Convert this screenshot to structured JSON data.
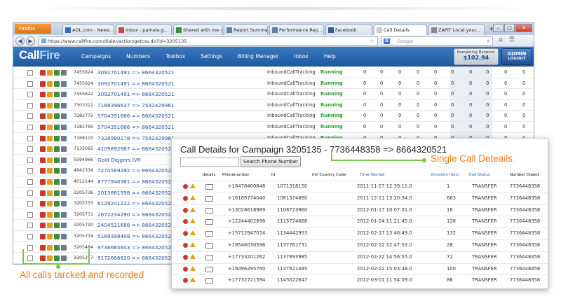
{
  "browser": {
    "app_button": "Firefox",
    "tabs": [
      {
        "label": "AOL.com - News...",
        "color": "#2a6cc7"
      },
      {
        "label": "Inbox - pamela.g...",
        "color": "#d44638"
      },
      {
        "label": "Shared with me -...",
        "color": "#3b8f3b"
      },
      {
        "label": "Report Summary",
        "color": "#5f7fa8"
      },
      {
        "label": "Performance Rep...",
        "color": "#5f7fa8"
      },
      {
        "label": "Facebook",
        "color": "#3b5998"
      },
      {
        "label": "Call Details",
        "color": "#cccccc"
      },
      {
        "label": "ZAPIT Local your...",
        "color": "#888888"
      }
    ],
    "new_tab": "+",
    "url": "https://www.callfire.com/dialer/action/getcsv.do?id=3205135",
    "search_placeholder": "Google",
    "search_engine": "G"
  },
  "app": {
    "logo_a": "Call",
    "logo_b": "Fire",
    "menu": [
      "Campaigns",
      "Numbers",
      "Toolbox",
      "Settings",
      "Billing Manager",
      "Inbox",
      "Help"
    ],
    "balance_label": "Remaining Balance:",
    "balance_value": "$102.94",
    "admin_label": "ADMIN",
    "logout_label": "LOGOUT"
  },
  "calls": [
    {
      "id": "7455624",
      "number": "3092701491 => 8664320521",
      "type": "InboundCallTracking",
      "status": "Running"
    },
    {
      "id": "7455624",
      "number": "3092701491 => 8664320521",
      "type": "InboundCallTracking",
      "status": "Running"
    },
    {
      "id": "7455622",
      "number": "3092701491 => 8664320521",
      "type": "InboundCallTracking",
      "status": "Running"
    },
    {
      "id": "7303312",
      "number": "7188396637 => 7542429961",
      "type": "InboundCallTracking",
      "status": "Running"
    },
    {
      "id": "7282772",
      "number": "5704351686 => 8664320521",
      "type": "InboundCallTracking",
      "status": "Running"
    },
    {
      "id": "7282769",
      "number": "5704351686 => 8664320521",
      "type": "InboundCallTracking",
      "status": "Running"
    },
    {
      "id": "7168103",
      "number": "7328980178 => 7542429961",
      "type": "InboundCallTracking",
      "status": "Running"
    },
    {
      "id": "7135065",
      "number": "4109892987 => 8664320521",
      "type": "InboundCallTracking",
      "status": "Running"
    },
    {
      "id": "5594966",
      "number": "Gold Diggers IVR",
      "type": "",
      "status": ""
    },
    {
      "id": "4842334",
      "number": "7274569292 => 8664320521",
      "type": "",
      "status": ""
    },
    {
      "id": "4012144",
      "number": "8777940381 => 8664320521",
      "type": "",
      "status": ""
    },
    {
      "id": "3205736",
      "number": "2015881598 => 8664320521",
      "type": "",
      "status": ""
    },
    {
      "id": "3205733",
      "number": "6129241222 => 8664320521",
      "type": "",
      "status": ""
    },
    {
      "id": "3205731",
      "number": "2672234290 => 8664320521",
      "type": "",
      "status": ""
    },
    {
      "id": "3205720",
      "number": "2404521688 => 8664320521",
      "type": "",
      "status": ""
    },
    {
      "id": "3205719",
      "number": "5169398408 => 8664320521",
      "type": "",
      "status": ""
    },
    {
      "id": "3205484",
      "number": "9738665643 => 8664320521",
      "type": "",
      "status": ""
    },
    {
      "id": "3205217",
      "number": "9172686620 => 8664320521",
      "type": "",
      "status": ""
    },
    {
      "id": "3205169",
      "number": "5619074442 => 8664320521",
      "type": "",
      "status": ""
    },
    {
      "id": "3205135",
      "number": "7736448358 => 8664320521",
      "type": "",
      "status": ""
    }
  ],
  "zero": "0",
  "popup": {
    "title": "Call Details for Campaign 3205135 - 7736448358 => 8664320521",
    "search_button": "Search Phone Number",
    "headers": [
      "details",
      "Phonenumber",
      "Id",
      "Intl Country Code",
      "Time Started",
      "Duration (Sec)",
      "Call Status",
      "Number Dialed"
    ],
    "rows": [
      {
        "phone": "+18478400848",
        "id": "1071318150",
        "time": "2011-11-27 12:39:11.0",
        "dur": "1",
        "status": "TRANSFER",
        "dialed": "7736448358"
      },
      {
        "phone": "+16189774040",
        "id": "1081374860",
        "time": "2011-12-11 13:20:34.0",
        "dur": "663",
        "status": "TRANSFER",
        "dialed": "7736448358"
      },
      {
        "phone": "+13028618989",
        "id": "1108723960",
        "time": "2012-01-17 10:07:01.0",
        "dur": "18",
        "status": "TRANSFER",
        "dialed": "7736448358"
      },
      {
        "phone": "+12244402896",
        "id": "1115724668",
        "time": "2012-01-24 11:21:45.0",
        "dur": "128",
        "status": "TRANSFER",
        "dialed": "7736448358"
      },
      {
        "phone": "+15712947074",
        "id": "1134442953",
        "time": "2012-02-17 13:46:49.0",
        "dur": "132",
        "status": "TRANSFER",
        "dialed": "7736448358"
      },
      {
        "phone": "+19546030596",
        "id": "1137761731",
        "time": "2012-02-22 12:47:53.0",
        "dur": "28",
        "status": "TRANSFER",
        "dialed": "7736448358"
      },
      {
        "phone": "+17733201262",
        "id": "1137893985",
        "time": "2012-02-22 14:56:55.0",
        "dur": "72",
        "status": "TRANSFER",
        "dialed": "7736448358"
      },
      {
        "phone": "+19496295760",
        "id": "1137921495",
        "time": "2012-02-22 15:03:48.0",
        "dur": "100",
        "status": "TRANSFER",
        "dialed": "7736448358"
      },
      {
        "phone": "+17732721594",
        "id": "1145022647",
        "time": "2012-03-01 11:54:09.0",
        "dur": "86",
        "status": "TRANSFER",
        "dialed": "7736448358"
      }
    ]
  },
  "annotations": {
    "single": "Single Call Deteails",
    "all": "All calls tarcked and recorded"
  },
  "colors": {
    "accent": "#f07c18",
    "callout": "#7cc44e",
    "link": "#1b4f9c",
    "running": "#2f9a2f"
  }
}
